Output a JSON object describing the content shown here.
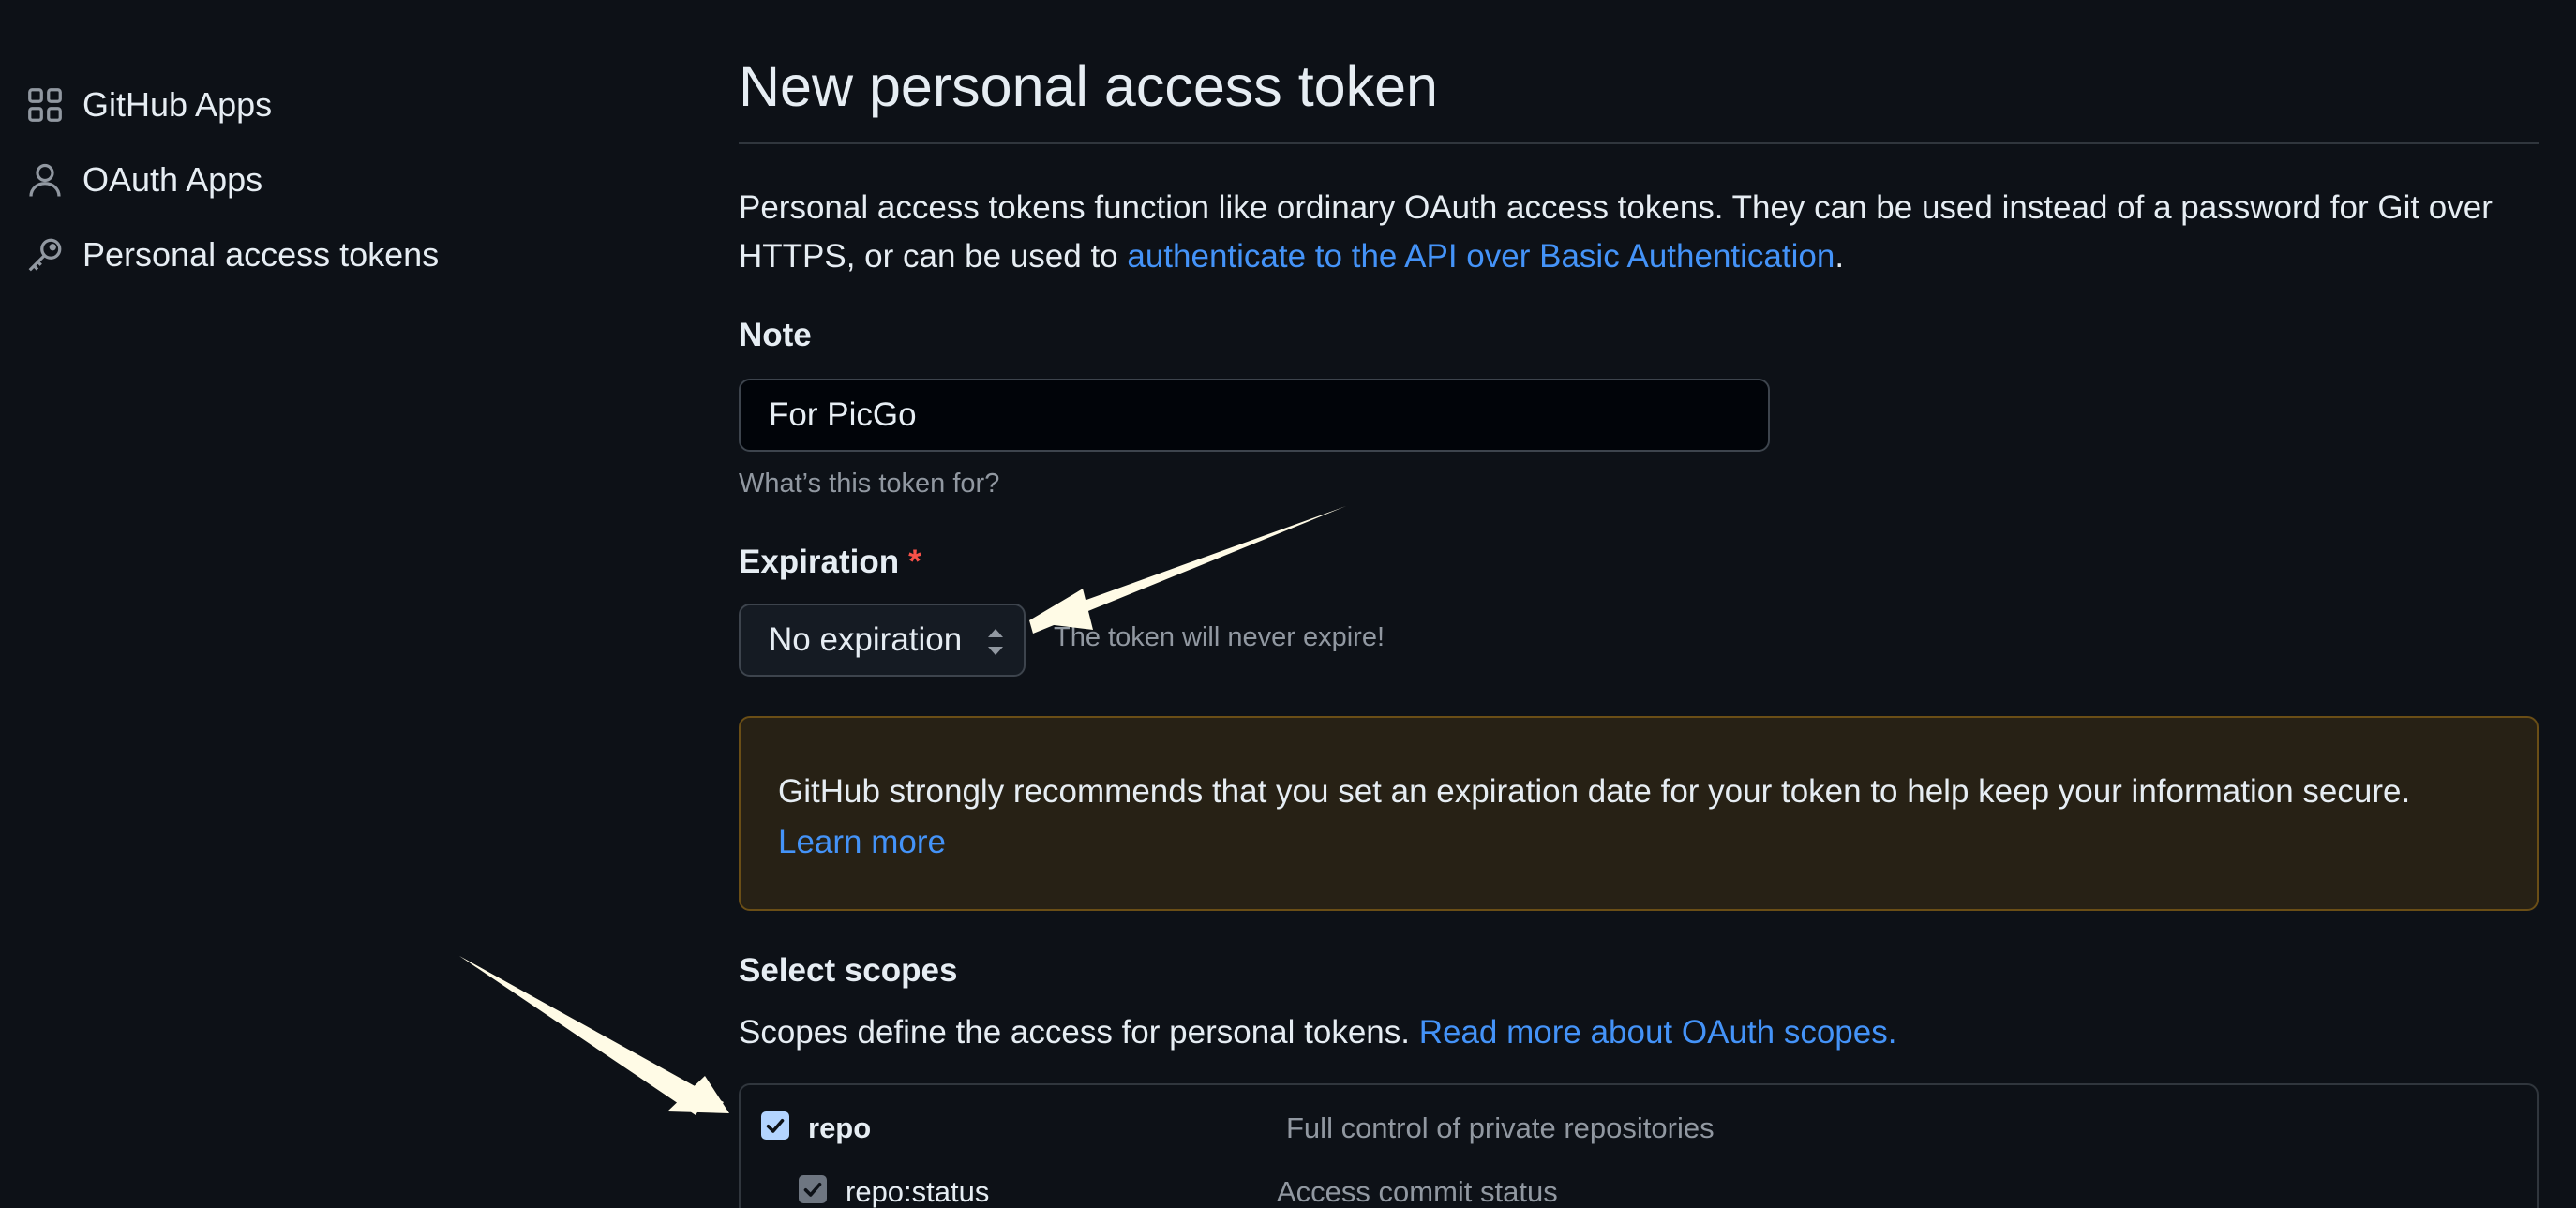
{
  "sidebar": {
    "items": [
      {
        "label": "GitHub Apps",
        "icon": "apps-grid-icon"
      },
      {
        "label": "OAuth Apps",
        "icon": "person-icon"
      },
      {
        "label": "Personal access tokens",
        "icon": "key-icon"
      }
    ]
  },
  "page": {
    "title": "New personal access token",
    "intro_text": "Personal access tokens function like ordinary OAuth access tokens. They can be used instead of a password for Git over HTTPS, or can be used to ",
    "intro_link": "authenticate to the API over Basic Authentication",
    "intro_end": "."
  },
  "note": {
    "label": "Note",
    "value": "For PicGo",
    "hint": "What’s this token for?"
  },
  "expiration": {
    "label": "Expiration",
    "required_mark": "*",
    "selected": "No expiration",
    "hint": "The token will never expire!"
  },
  "warning": {
    "text": "GitHub strongly recommends that you set an expiration date for your token to help keep your information secure.",
    "link": "Learn more"
  },
  "scopes": {
    "heading": "Select scopes",
    "desc": "Scopes define the access for personal tokens. ",
    "link": "Read more about OAuth scopes.",
    "items": [
      {
        "name": "repo",
        "description": "Full control of private repositories",
        "checked": true
      },
      {
        "name": "repo:status",
        "description": "Access commit status",
        "checked": true
      }
    ]
  },
  "colors": {
    "background": "#0d1117",
    "link": "#4493f8",
    "warning_bg": "#272115",
    "annotation_arrow": "#fffbe6"
  }
}
